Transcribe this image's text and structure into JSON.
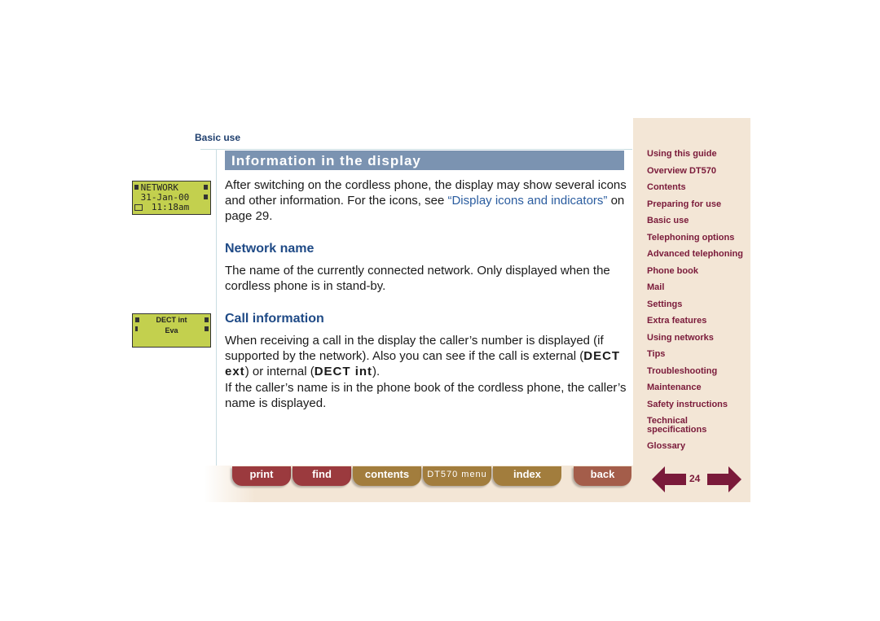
{
  "header": {
    "section": "Basic use"
  },
  "main": {
    "title": "Information in the display",
    "intro": {
      "text_before": "After switching on the cordless phone, the display may show several icons and other information. For the icons, see ",
      "link": "“Display icons and indicators”",
      "text_after": " on page 29."
    },
    "sections": [
      {
        "heading": "Network name",
        "body": "The name of the currently connected network. Only displayed when the cordless phone is in stand-by."
      },
      {
        "heading": "Call information",
        "body_p1_a": "When receiving a call in the display the caller’s number is displayed (if supported by the network). Also you can see if the call is external (",
        "body_p1_ext": "DECT ext",
        "body_p1_b": ") or internal (",
        "body_p1_int": "DECT int",
        "body_p1_c": ").",
        "body_p2": "If the caller’s name is in the phone book of the cordless phone, the caller’s name is displayed."
      }
    ]
  },
  "displays": {
    "standby": {
      "line1": " NETWORK",
      "line2": " 31-Jan-00",
      "line3": "   11:18am"
    },
    "call": {
      "line1": "DECT int",
      "line2": "Eva"
    }
  },
  "sidebar": {
    "items": [
      "Using this guide",
      "Overview DT570",
      "Contents",
      "Preparing for use",
      "Basic use",
      "Telephoning options",
      "Advanced telephoning",
      "Phone book",
      "Mail",
      "Settings",
      "Extra features",
      "Using networks",
      "Tips",
      "Troubleshooting",
      "Maintenance",
      "Safety instructions",
      "Technical specifications",
      "Glossary"
    ]
  },
  "footer": {
    "tabs": [
      "print",
      "find",
      "contents",
      "DT570 menu",
      "index",
      "back"
    ],
    "page_number": "24",
    "prev_icon": "arrow-left-icon",
    "next_icon": "arrow-right-icon"
  },
  "colors": {
    "title_bar": "#7b93b1",
    "heading": "#1f4a86",
    "link": "#2a5c9f",
    "sidebar_bg": "#f3e6d6",
    "nav_text": "#7a1a3a",
    "tab_red": "#9b3a3e",
    "tab_gold": "#a27d3d",
    "lcd": "#c3d04e"
  }
}
